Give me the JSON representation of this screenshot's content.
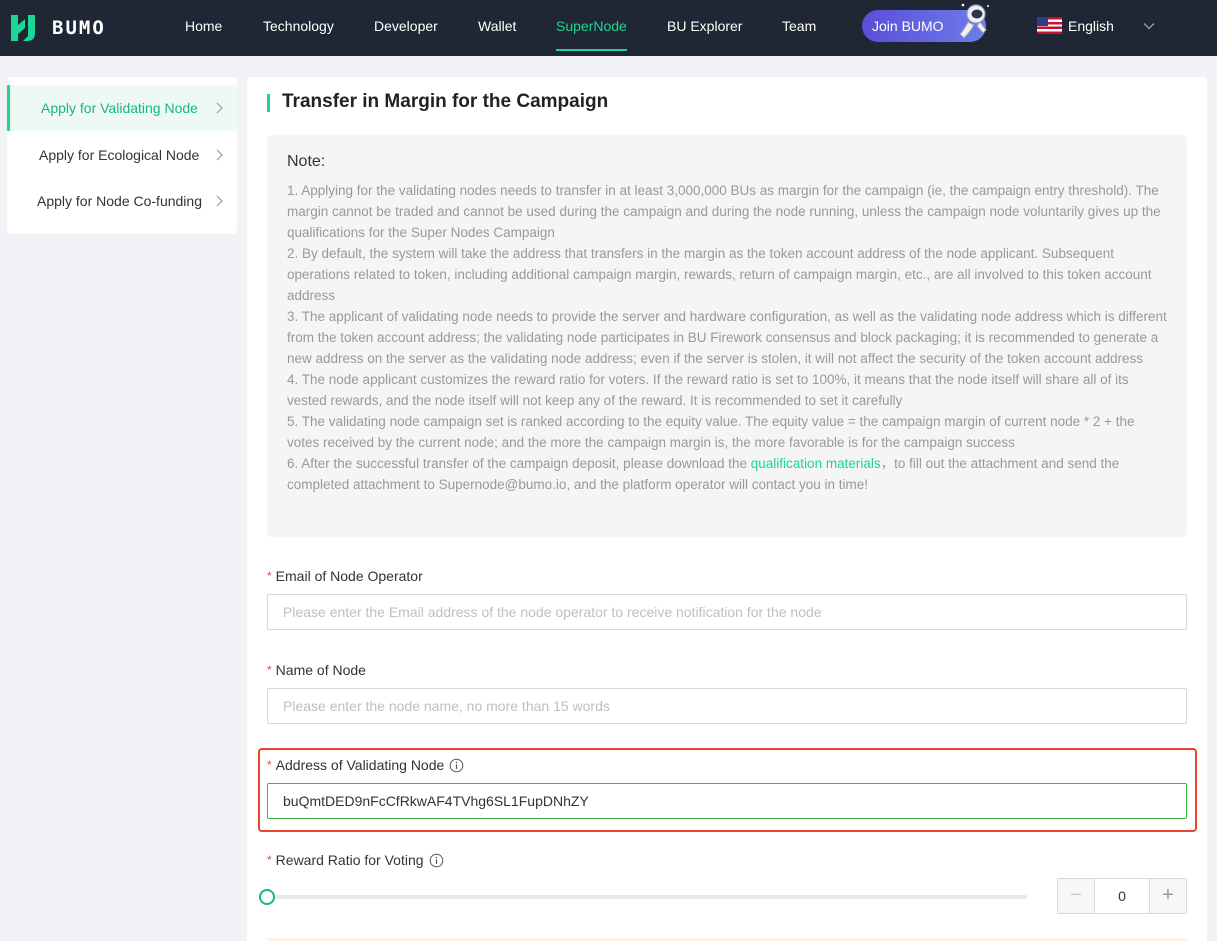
{
  "brand": {
    "logo_text": "BUMO",
    "accent": "#1ad697",
    "nav_bg": "#1e2733"
  },
  "nav": {
    "items": [
      "Home",
      "Technology",
      "Developer",
      "Wallet",
      "SuperNode",
      "BU Explorer",
      "Team"
    ],
    "active": "SuperNode",
    "join_label": "Join BUMO",
    "language": "English"
  },
  "sidebar": {
    "items": [
      {
        "label": "Apply for Validating Node",
        "active": true
      },
      {
        "label": "Apply for Ecological Node",
        "active": false
      },
      {
        "label": "Apply for Node Co-funding",
        "active": false
      }
    ]
  },
  "main": {
    "title": "Transfer in Margin for the Campaign",
    "note": {
      "heading": "Note:",
      "lines": [
        "1. Applying for the validating nodes needs to transfer in at least 3,000,000 BUs as margin for the campaign (ie, the campaign entry threshold). The margin cannot be traded and cannot be used during the campaign and during the node running, unless the campaign node voluntarily gives up the qualifications for the Super Nodes Campaign",
        "2. By default, the system will take the address that transfers in the margin as the token account address of the node applicant. Subsequent operations related to token, including additional campaign margin, rewards, return of campaign margin, etc., are all involved to this token account address",
        "3. The applicant of validating node needs to provide the server and hardware configuration, as well as the validating node address which is different from the token account address; the validating node participates in BU Firework consensus and block packaging; it is recommended to generate a new address on the server as the validating node address; even if the server is stolen, it will not affect the security of the token account address",
        "4. The node applicant customizes the reward ratio for voters. If the reward ratio is set to 100%, it means that the node itself will share all of its vested rewards, and the node itself will not keep any of the reward. It is recommended to set it carefully",
        "5. The validating node campaign set is ranked according to the equity value. The equity value = the campaign margin of current node * 2 + the votes received by the current node; and the more the campaign margin is, the more favorable is for the campaign success"
      ],
      "line6_before": "6. After the successful transfer of the campaign deposit, please download the ",
      "line6_link": "qualification materials",
      "line6_after": "，to fill out the attachment and send the completed attachment to Supernode@bumo.io, and the platform operator will contact you in time!"
    },
    "form": {
      "email_label": "Email of Node Operator",
      "email_placeholder": "Please enter the Email address of the node operator to receive notification for the node",
      "name_label": "Name of Node",
      "name_placeholder": "Please enter the node name, no more than 15 words",
      "address_label": "Address of Validating Node",
      "address_value": "buQmtDED9nFcCfRkwAF4TVhg6SL1FupDNhZY",
      "reward_label": "Reward Ratio for Voting",
      "reward_value": "0",
      "reward_slider_fraction": 0,
      "required_mark": "*"
    }
  }
}
